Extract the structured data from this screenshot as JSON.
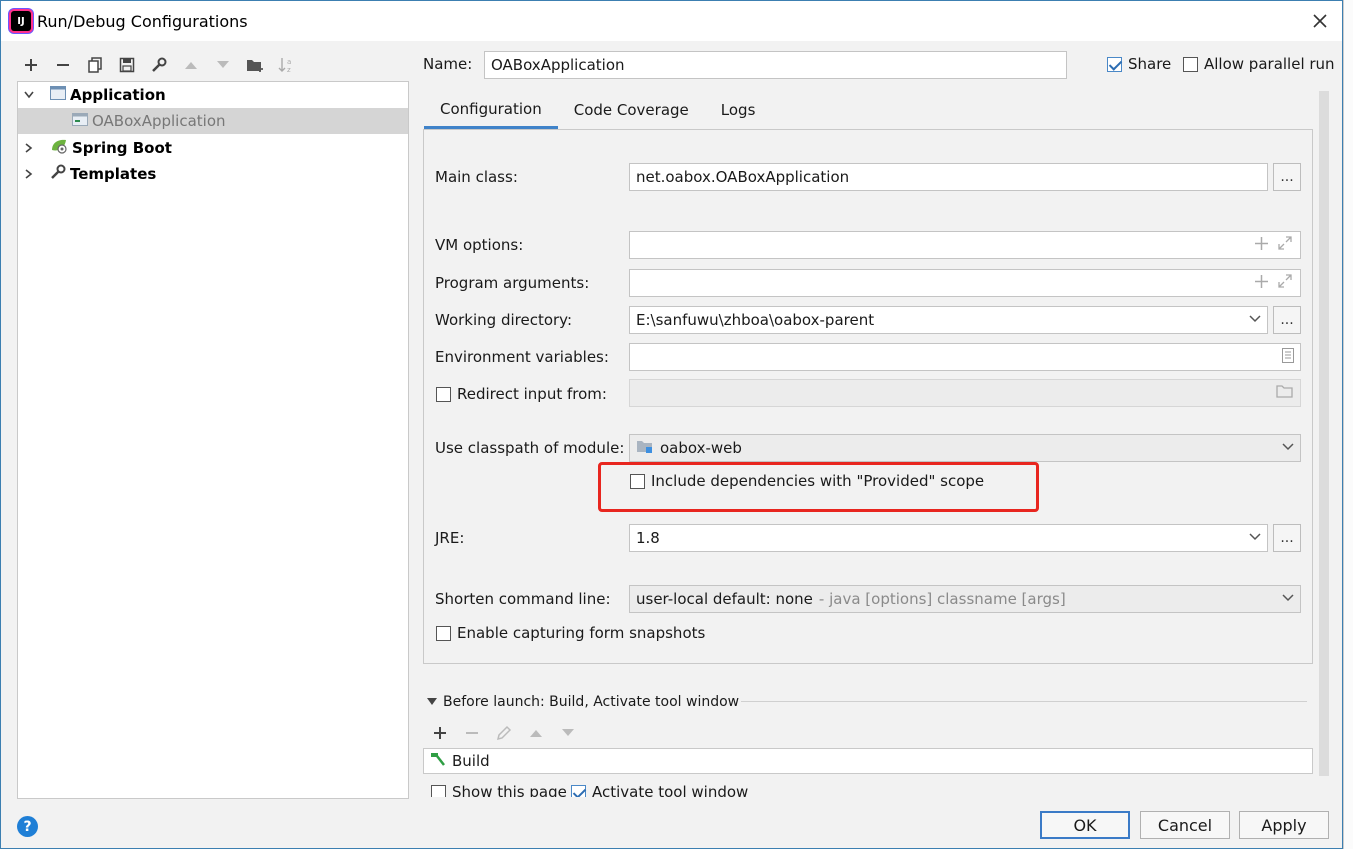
{
  "window": {
    "title": "Run/Debug Configurations",
    "app_icon_text": "IJ"
  },
  "toolbar": {
    "items": [
      "add-icon",
      "remove-icon",
      "copy-icon",
      "save-icon",
      "wrench-icon",
      "move-up-icon",
      "move-down-icon",
      "folder-add-icon",
      "sort-icon"
    ]
  },
  "tree": {
    "items": [
      {
        "label": "Application",
        "bold": true,
        "expanded": true
      },
      {
        "label": "OABoxApplication",
        "bold": false,
        "selected": true
      },
      {
        "label": "Spring Boot",
        "bold": true,
        "expanded": false
      },
      {
        "label": "Templates",
        "bold": true,
        "expanded": false
      }
    ]
  },
  "header": {
    "name_label": "Name:",
    "name_value": "OABoxApplication",
    "share_label": "Share",
    "share_checked": true,
    "parallel_label": "Allow parallel run",
    "parallel_checked": false
  },
  "tabs": [
    {
      "label": "Configuration",
      "active": true
    },
    {
      "label": "Code Coverage",
      "active": false
    },
    {
      "label": "Logs",
      "active": false
    }
  ],
  "config": {
    "main_class_label": "Main class:",
    "main_class_value": "net.oabox.OABoxApplication",
    "vm_options_label": "VM options:",
    "vm_options_value": "",
    "program_args_label": "Program arguments:",
    "program_args_value": "",
    "working_dir_label": "Working directory:",
    "working_dir_value": "E:\\sanfuwu\\zhboa\\oabox-parent",
    "env_vars_label": "Environment variables:",
    "env_vars_value": "",
    "redirect_label": "Redirect input from:",
    "redirect_value": "",
    "classpath_label": "Use classpath of module:",
    "classpath_value": "oabox-web",
    "provided_label": "Include dependencies with \"Provided\" scope",
    "jre_label": "JRE:",
    "jre_value": "1.8",
    "shorten_label": "Shorten command line:",
    "shorten_value": "user-local default: none",
    "shorten_hint": "- java [options] classname [args]",
    "snapshots_label": "Enable capturing form snapshots",
    "dots": "..."
  },
  "before_launch": {
    "header": "Before launch: Build, Activate tool window",
    "task": "Build",
    "show_page_label": "Show this page",
    "activate_label": "Activate tool window"
  },
  "buttons": {
    "ok": "OK",
    "cancel": "Cancel",
    "apply": "Apply",
    "help": "?"
  },
  "colors": {
    "accent": "#4083c9",
    "highlight": "#e8261f"
  }
}
